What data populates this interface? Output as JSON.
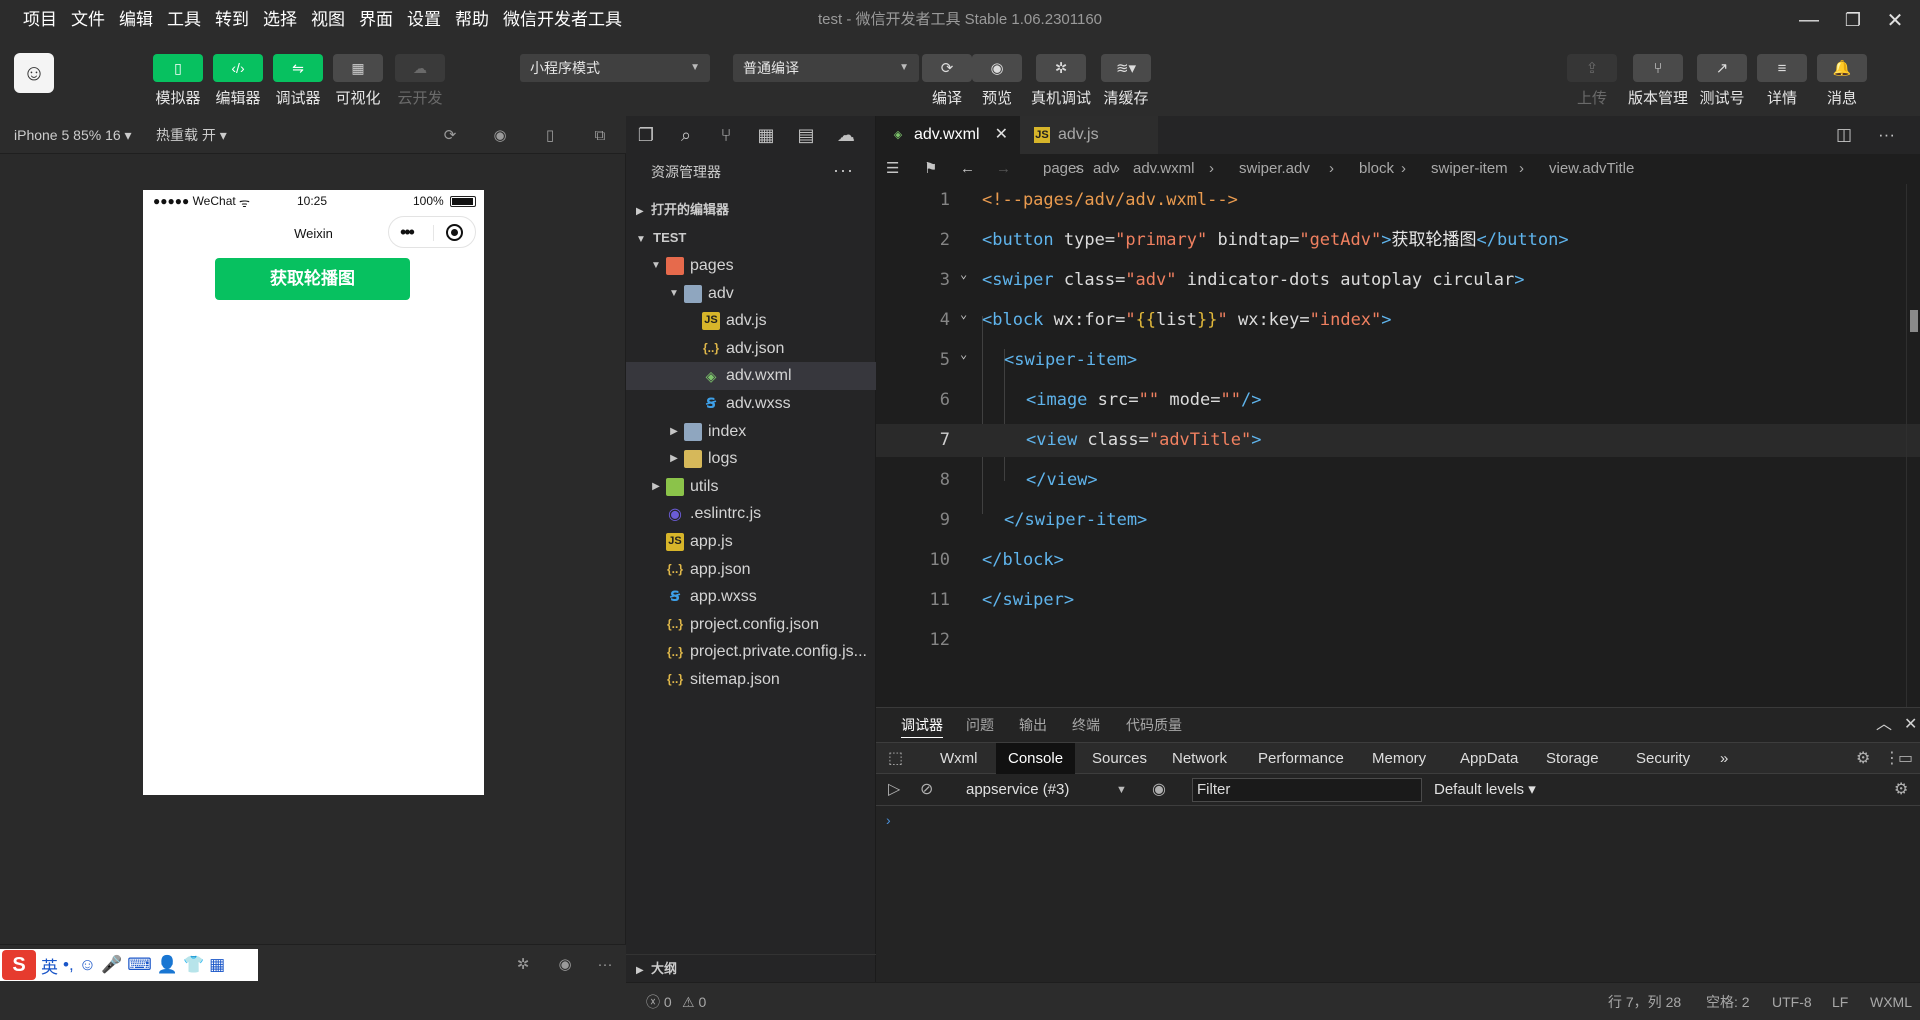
{
  "menu": [
    "项目",
    "文件",
    "编辑",
    "工具",
    "转到",
    "选择",
    "视图",
    "界面",
    "设置",
    "帮助",
    "微信开发者工具"
  ],
  "window_title": "test - 微信开发者工具 Stable 1.06.2301160",
  "window_controls": {
    "minimize": "—",
    "restore": "❐",
    "close": "✕"
  },
  "toolbar": {
    "mode_buttons": [
      {
        "label": "模拟器",
        "icon": "phone-icon",
        "glyph": "▯",
        "state": "on"
      },
      {
        "label": "编辑器",
        "icon": "code-icon",
        "glyph": "‹/›",
        "state": "on"
      },
      {
        "label": "调试器",
        "icon": "sliders-icon",
        "glyph": "⇋",
        "state": "on"
      },
      {
        "label": "可视化",
        "icon": "layout-icon",
        "glyph": "▦",
        "state": "off"
      },
      {
        "label": "云开发",
        "icon": "cloud-icon",
        "glyph": "☁",
        "state": "disabled"
      }
    ],
    "mode_select": "小程序模式",
    "compile_select": "普通编译",
    "actions": [
      {
        "label": "编译",
        "icon": "refresh-icon",
        "glyph": "⟳"
      },
      {
        "label": "预览",
        "icon": "eye-icon",
        "glyph": "◉"
      },
      {
        "label": "真机调试",
        "icon": "bug-icon",
        "glyph": "✲"
      },
      {
        "label": "清缓存",
        "icon": "layers-icon",
        "glyph": "≋▾"
      }
    ],
    "right_actions": [
      {
        "label": "上传",
        "icon": "upload-icon",
        "glyph": "⇪",
        "disabled": true
      },
      {
        "label": "版本管理",
        "icon": "branch-icon",
        "glyph": "⑂",
        "disabled": false
      },
      {
        "label": "测试号",
        "icon": "external-link-icon",
        "glyph": "↗",
        "disabled": false
      },
      {
        "label": "详情",
        "icon": "menu-icon",
        "glyph": "≡",
        "disabled": false
      },
      {
        "label": "消息",
        "icon": "bell-icon",
        "glyph": "🔔",
        "disabled": false
      }
    ]
  },
  "simulator": {
    "device": "iPhone 5 85% 16 ▾",
    "hot_reload": "热重载 开 ▾",
    "statusbar": {
      "carrier": "●●●●● WeChat",
      "wifi": "ᯤ",
      "time": "10:25",
      "battery": "100%"
    },
    "nav_title": "Weixin",
    "capsule_dots": "•••",
    "button_label": "获取轮播图"
  },
  "ime": {
    "logo": "S",
    "items": [
      "英",
      "•,",
      "☺",
      "🎤",
      "⌨",
      "👤",
      "👕",
      "▦"
    ]
  },
  "explorer": {
    "title": "资源管理器",
    "more": "···",
    "open_editors": "打开的编辑器",
    "project": "TEST",
    "tree": [
      {
        "name": "pages",
        "level": 1,
        "type": "folder-red",
        "arrow": "▼"
      },
      {
        "name": "adv",
        "level": 2,
        "type": "folder",
        "arrow": "▼"
      },
      {
        "name": "adv.js",
        "level": 3,
        "type": "js"
      },
      {
        "name": "adv.json",
        "level": 3,
        "type": "json"
      },
      {
        "name": "adv.wxml",
        "level": 3,
        "type": "wxml",
        "selected": true
      },
      {
        "name": "adv.wxss",
        "level": 3,
        "type": "wxss"
      },
      {
        "name": "index",
        "level": 2,
        "type": "folder",
        "arrow": "▶"
      },
      {
        "name": "logs",
        "level": 2,
        "type": "folder-yel",
        "arrow": "▶"
      },
      {
        "name": "utils",
        "level": 1,
        "type": "folder-grn",
        "arrow": "▶"
      },
      {
        "name": ".eslintrc.js",
        "level": 1,
        "type": "eslint"
      },
      {
        "name": "app.js",
        "level": 1,
        "type": "js"
      },
      {
        "name": "app.json",
        "level": 1,
        "type": "json"
      },
      {
        "name": "app.wxss",
        "level": 1,
        "type": "wxss"
      },
      {
        "name": "project.config.json",
        "level": 1,
        "type": "json"
      },
      {
        "name": "project.private.config.js...",
        "level": 1,
        "type": "json"
      },
      {
        "name": "sitemap.json",
        "level": 1,
        "type": "json"
      }
    ],
    "outline": "大纲"
  },
  "editor": {
    "tabs": [
      {
        "name": "adv.wxml",
        "type": "wxml",
        "active": true,
        "close": "✕"
      },
      {
        "name": "adv.js",
        "type": "js",
        "active": false
      }
    ],
    "breadcrumb": [
      "pages",
      "adv",
      "adv.wxml",
      "swiper.adv",
      "block",
      "swiper-item",
      "view.advTitle"
    ],
    "current_line": 7,
    "lines": [
      {
        "n": "1",
        "tokens": [
          [
            "cm",
            "<!--pages/adv/adv.wxml-->"
          ]
        ]
      },
      {
        "n": "2",
        "tokens": [
          [
            "tag",
            "<button"
          ],
          [
            "attr",
            " type="
          ],
          [
            "str",
            "\"primary\""
          ],
          [
            "attr",
            " bindtap="
          ],
          [
            "str",
            "\"getAdv\""
          ],
          [
            "tag",
            ">"
          ],
          [
            "txt",
            "获取轮播图"
          ],
          [
            "tag",
            "</button>"
          ]
        ]
      },
      {
        "n": "3",
        "fold": true,
        "tokens": [
          [
            "tag",
            "<swiper"
          ],
          [
            "attr",
            " class="
          ],
          [
            "str",
            "\"adv\""
          ],
          [
            "attr",
            " indicator-dots autoplay circular"
          ],
          [
            "tag",
            ">"
          ]
        ]
      },
      {
        "n": "4",
        "fold": true,
        "tokens": [
          [
            "tag",
            "<block"
          ],
          [
            "attr",
            " wx:for="
          ],
          [
            "str",
            "\""
          ],
          [
            "br",
            "{{"
          ],
          [
            "attr",
            "list"
          ],
          [
            "br",
            "}}"
          ],
          [
            "str",
            "\""
          ],
          [
            "attr",
            " wx:key="
          ],
          [
            "str",
            "\"index\""
          ],
          [
            "tag",
            ">"
          ]
        ]
      },
      {
        "n": "5",
        "fold": true,
        "indent": 1,
        "tokens": [
          [
            "tag",
            "<swiper-item>"
          ]
        ]
      },
      {
        "n": "6",
        "indent": 2,
        "tokens": [
          [
            "tag",
            "<image"
          ],
          [
            "attr",
            " src="
          ],
          [
            "str",
            "\"\""
          ],
          [
            "attr",
            " mode="
          ],
          [
            "str",
            "\"\""
          ],
          [
            "tag",
            "/>"
          ]
        ]
      },
      {
        "n": "7",
        "indent": 2,
        "tokens": [
          [
            "tag",
            "<view"
          ],
          [
            "attr",
            " class="
          ],
          [
            "str",
            "\"advTitle\""
          ],
          [
            "tag",
            ">"
          ]
        ]
      },
      {
        "n": "8",
        "indent": 2,
        "tokens": [
          [
            "tag",
            "</view>"
          ]
        ]
      },
      {
        "n": "9",
        "indent": 1,
        "tokens": [
          [
            "tag",
            "</swiper-item>"
          ]
        ]
      },
      {
        "n": "10",
        "tokens": [
          [
            "tag",
            "</block>"
          ]
        ]
      },
      {
        "n": "11",
        "tokens": [
          [
            "tag",
            "</swiper>"
          ]
        ]
      },
      {
        "n": "12",
        "tokens": []
      }
    ]
  },
  "debugger": {
    "panel_tabs": [
      "调试器",
      "问题",
      "输出",
      "终端",
      "代码质量"
    ],
    "active_panel_tab": 0,
    "devtools_tabs": [
      "Wxml",
      "Console",
      "Sources",
      "Network",
      "Performance",
      "Memory",
      "AppData",
      "Storage",
      "Security"
    ],
    "active_devtools_tab": 1,
    "more_tabs": "»",
    "context": "appservice (#3)",
    "filter_placeholder": "Filter",
    "levels": "Default levels ▾",
    "prompt": "›"
  },
  "statusbar": {
    "errors": "ⓧ 0",
    "warnings": "⚠ 0",
    "position": "行 7，列 28",
    "spaces": "空格: 2",
    "encoding": "UTF-8",
    "eol": "LF",
    "language": "WXML"
  },
  "colors": {
    "accent": "#07c160",
    "tag": "#5fb4ec",
    "string": "#f08060",
    "comment": "#ea9b4f"
  }
}
